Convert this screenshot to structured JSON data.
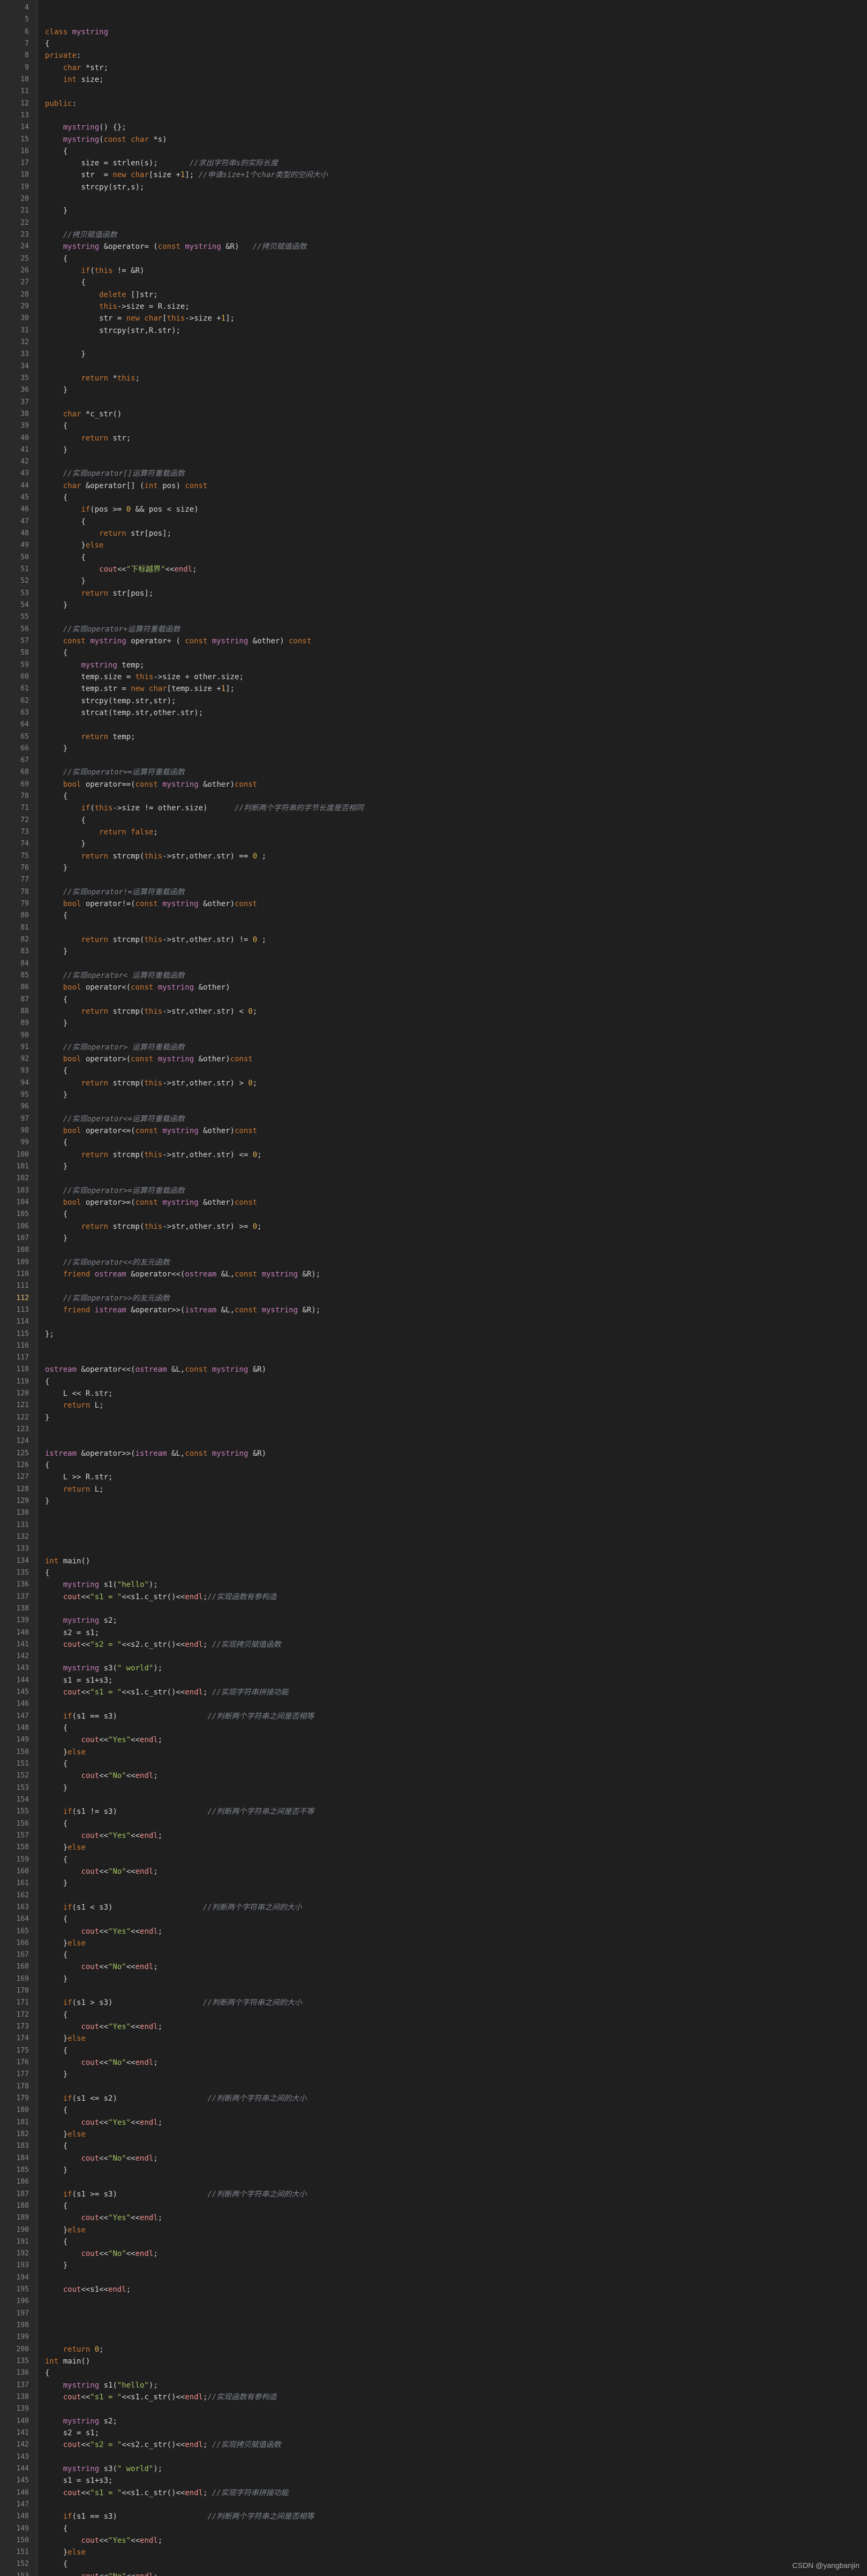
{
  "editor": {
    "active_line": 112,
    "lines": [
      {
        "n": 4,
        "t": ""
      },
      {
        "n": 5,
        "t": ""
      },
      {
        "n": 6,
        "t": "class mystring"
      },
      {
        "n": 7,
        "t": "{"
      },
      {
        "n": 8,
        "t": "private:"
      },
      {
        "n": 9,
        "t": "    char *str;"
      },
      {
        "n": 10,
        "t": "    int size;"
      },
      {
        "n": 11,
        "t": ""
      },
      {
        "n": 12,
        "t": "public:"
      },
      {
        "n": 13,
        "t": ""
      },
      {
        "n": 14,
        "t": "    mystring() {};"
      },
      {
        "n": 15,
        "t": "    mystring(const char *s)"
      },
      {
        "n": 16,
        "t": "    {"
      },
      {
        "n": 17,
        "t": "        size = strlen(s);       //求出字符串s的实际长度"
      },
      {
        "n": 18,
        "t": "        str  = new char[size +1]; //申请size+1个char类型的空间大小"
      },
      {
        "n": 19,
        "t": "        strcpy(str,s);"
      },
      {
        "n": 20,
        "t": ""
      },
      {
        "n": 21,
        "t": "    }"
      },
      {
        "n": 22,
        "t": ""
      },
      {
        "n": 23,
        "t": "    //拷贝赋值函数"
      },
      {
        "n": 24,
        "t": "    mystring &operator= (const mystring &R)   //拷贝赋值函数"
      },
      {
        "n": 25,
        "t": "    {"
      },
      {
        "n": 26,
        "t": "        if(this != &R)"
      },
      {
        "n": 27,
        "t": "        {"
      },
      {
        "n": 28,
        "t": "            delete []str;"
      },
      {
        "n": 29,
        "t": "            this->size = R.size;"
      },
      {
        "n": 30,
        "t": "            str = new char[this->size +1];"
      },
      {
        "n": 31,
        "t": "            strcpy(str,R.str);"
      },
      {
        "n": 32,
        "t": ""
      },
      {
        "n": 33,
        "t": "        }"
      },
      {
        "n": 34,
        "t": ""
      },
      {
        "n": 35,
        "t": "        return *this;"
      },
      {
        "n": 36,
        "t": "    }"
      },
      {
        "n": 37,
        "t": ""
      },
      {
        "n": 38,
        "t": "    char *c_str()"
      },
      {
        "n": 39,
        "t": "    {"
      },
      {
        "n": 40,
        "t": "        return str;"
      },
      {
        "n": 41,
        "t": "    }"
      },
      {
        "n": 42,
        "t": ""
      },
      {
        "n": 43,
        "t": "    //实现operator[]运算符重载函数"
      },
      {
        "n": 44,
        "t": "    char &operator[] (int pos) const"
      },
      {
        "n": 45,
        "t": "    {"
      },
      {
        "n": 46,
        "t": "        if(pos >= 0 && pos < size)"
      },
      {
        "n": 47,
        "t": "        {"
      },
      {
        "n": 48,
        "t": "            return str[pos];"
      },
      {
        "n": 49,
        "t": "        }else"
      },
      {
        "n": 50,
        "t": "        {"
      },
      {
        "n": 51,
        "t": "            cout<<\"下标越界\"<<endl;"
      },
      {
        "n": 52,
        "t": "        }"
      },
      {
        "n": 53,
        "t": "        return str[pos];"
      },
      {
        "n": 54,
        "t": "    }"
      },
      {
        "n": 55,
        "t": ""
      },
      {
        "n": 56,
        "t": "    //实现operator+运算符重载函数"
      },
      {
        "n": 57,
        "t": "    const mystring operator+ ( const mystring &other) const"
      },
      {
        "n": 58,
        "t": "    {"
      },
      {
        "n": 59,
        "t": "        mystring temp;"
      },
      {
        "n": 60,
        "t": "        temp.size = this->size + other.size;"
      },
      {
        "n": 61,
        "t": "        temp.str = new char[temp.size +1];"
      },
      {
        "n": 62,
        "t": "        strcpy(temp.str,str);"
      },
      {
        "n": 63,
        "t": "        strcat(temp.str,other.str);"
      },
      {
        "n": 64,
        "t": ""
      },
      {
        "n": 65,
        "t": "        return temp;"
      },
      {
        "n": 66,
        "t": "    }"
      },
      {
        "n": 67,
        "t": ""
      },
      {
        "n": 68,
        "t": "    //实现operator==运算符重载函数"
      },
      {
        "n": 69,
        "t": "    bool operator==(const mystring &other)const"
      },
      {
        "n": 70,
        "t": "    {"
      },
      {
        "n": 71,
        "t": "        if(this->size != other.size)      //判断两个字符串的字节长度是否相同"
      },
      {
        "n": 72,
        "t": "        {"
      },
      {
        "n": 73,
        "t": "            return false;"
      },
      {
        "n": 74,
        "t": "        }"
      },
      {
        "n": 75,
        "t": "        return strcmp(this->str,other.str) == 0 ;"
      },
      {
        "n": 76,
        "t": "    }"
      },
      {
        "n": 77,
        "t": ""
      },
      {
        "n": 78,
        "t": "    //实现operator!=运算符重载函数"
      },
      {
        "n": 79,
        "t": "    bool operator!=(const mystring &other)const"
      },
      {
        "n": 80,
        "t": "    {"
      },
      {
        "n": 81,
        "t": ""
      },
      {
        "n": 82,
        "t": "        return strcmp(this->str,other.str) != 0 ;"
      },
      {
        "n": 83,
        "t": "    }"
      },
      {
        "n": 84,
        "t": ""
      },
      {
        "n": 85,
        "t": "    //实现operator< 运算符重载函数"
      },
      {
        "n": 86,
        "t": "    bool operator<(const mystring &other)"
      },
      {
        "n": 87,
        "t": "    {"
      },
      {
        "n": 88,
        "t": "        return strcmp(this->str,other.str) < 0;"
      },
      {
        "n": 89,
        "t": "    }"
      },
      {
        "n": 90,
        "t": ""
      },
      {
        "n": 91,
        "t": "    //实现operator> 运算符重载函数"
      },
      {
        "n": 92,
        "t": "    bool operator>(const mystring &other)const"
      },
      {
        "n": 93,
        "t": "    {"
      },
      {
        "n": 94,
        "t": "        return strcmp(this->str,other.str) > 0;"
      },
      {
        "n": 95,
        "t": "    }"
      },
      {
        "n": 96,
        "t": ""
      },
      {
        "n": 97,
        "t": "    //实现operator<=运算符重载函数"
      },
      {
        "n": 98,
        "t": "    bool operator<=(const mystring &other)const"
      },
      {
        "n": 99,
        "t": "    {"
      },
      {
        "n": 100,
        "t": "        return strcmp(this->str,other.str) <= 0;"
      },
      {
        "n": 101,
        "t": "    }"
      },
      {
        "n": 102,
        "t": ""
      },
      {
        "n": 103,
        "t": "    //实现operator>=运算符重载函数"
      },
      {
        "n": 104,
        "t": "    bool operator>=(const mystring &other)const"
      },
      {
        "n": 105,
        "t": "    {"
      },
      {
        "n": 106,
        "t": "        return strcmp(this->str,other.str) >= 0;"
      },
      {
        "n": 107,
        "t": "    }"
      },
      {
        "n": 108,
        "t": ""
      },
      {
        "n": 109,
        "t": "    //实现operator<<的友元函数"
      },
      {
        "n": 110,
        "t": "    friend ostream &operator<<(ostream &L,const mystring &R);"
      },
      {
        "n": 111,
        "t": ""
      },
      {
        "n": 112,
        "t": "    //实现operator>>的友元函数"
      },
      {
        "n": 113,
        "t": "    friend istream &operator>>(istream &L,const mystring &R);"
      },
      {
        "n": 114,
        "t": ""
      },
      {
        "n": 115,
        "t": "};"
      },
      {
        "n": 116,
        "t": ""
      },
      {
        "n": 117,
        "t": ""
      },
      {
        "n": 118,
        "t": "ostream &operator<<(ostream &L,const mystring &R)"
      },
      {
        "n": 119,
        "t": "{"
      },
      {
        "n": 120,
        "t": "    L << R.str;"
      },
      {
        "n": 121,
        "t": "    return L;"
      },
      {
        "n": 122,
        "t": "}"
      },
      {
        "n": 123,
        "t": ""
      },
      {
        "n": 124,
        "t": ""
      },
      {
        "n": 125,
        "t": "istream &operator>>(istream &L,const mystring &R)"
      },
      {
        "n": 126,
        "t": "{"
      },
      {
        "n": 127,
        "t": "    L >> R.str;"
      },
      {
        "n": 128,
        "t": "    return L;"
      },
      {
        "n": 129,
        "t": "}"
      },
      {
        "n": 130,
        "t": ""
      },
      {
        "n": 131,
        "t": ""
      },
      {
        "n": 132,
        "t": ""
      },
      {
        "n": 133,
        "t": ""
      },
      {
        "n": 134,
        "t": "int main()"
      },
      {
        "n": 135,
        "t": "{"
      },
      {
        "n": 136,
        "t": "    mystring s1(\"hello\");"
      },
      {
        "n": 137,
        "t": "    cout<<\"s1 = \"<<s1.c_str()<<endl;//实现函数有参构造"
      },
      {
        "n": 138,
        "t": ""
      },
      {
        "n": 139,
        "t": "    mystring s2;"
      },
      {
        "n": 140,
        "t": "    s2 = s1;"
      },
      {
        "n": 141,
        "t": "    cout<<\"s2 = \"<<s2.c_str()<<endl; //实现拷贝赋值函数"
      },
      {
        "n": 142,
        "t": ""
      },
      {
        "n": 143,
        "t": "    mystring s3(\" world\");"
      },
      {
        "n": 144,
        "t": "    s1 = s1+s3;"
      },
      {
        "n": 145,
        "t": "    cout<<\"s1 = \"<<s1.c_str()<<endl; //实现字符串拼接功能"
      },
      {
        "n": 146,
        "t": ""
      },
      {
        "n": 147,
        "t": "    if(s1 == s3)                    //判断两个字符串之间是否相等"
      },
      {
        "n": 148,
        "t": "    {"
      },
      {
        "n": 149,
        "t": "        cout<<\"Yes\"<<endl;"
      },
      {
        "n": 150,
        "t": "    }else"
      },
      {
        "n": 151,
        "t": "    {"
      },
      {
        "n": 152,
        "t": "        cout<<\"No\"<<endl;"
      },
      {
        "n": 153,
        "t": "    }"
      },
      {
        "n": 154,
        "t": ""
      },
      {
        "n": 155,
        "t": "    if(s1 != s3)                    //判断两个字符串之间是否不等"
      },
      {
        "n": 156,
        "t": "    {"
      },
      {
        "n": 157,
        "t": "        cout<<\"Yes\"<<endl;"
      },
      {
        "n": 158,
        "t": "    }else"
      },
      {
        "n": 159,
        "t": "    {"
      },
      {
        "n": 160,
        "t": "        cout<<\"No\"<<endl;"
      },
      {
        "n": 161,
        "t": "    }"
      },
      {
        "n": 162,
        "t": ""
      },
      {
        "n": 163,
        "t": "    if(s1 < s3)                    //判断两个字符串之间的大小"
      },
      {
        "n": 164,
        "t": "    {"
      },
      {
        "n": 165,
        "t": "        cout<<\"Yes\"<<endl;"
      },
      {
        "n": 166,
        "t": "    }else"
      },
      {
        "n": 167,
        "t": "    {"
      },
      {
        "n": 168,
        "t": "        cout<<\"No\"<<endl;"
      },
      {
        "n": 169,
        "t": "    }"
      },
      {
        "n": 170,
        "t": ""
      },
      {
        "n": 171,
        "t": "    if(s1 > s3)                    //判断两个字符串之间的大小"
      },
      {
        "n": 172,
        "t": "    {"
      },
      {
        "n": 173,
        "t": "        cout<<\"Yes\"<<endl;"
      },
      {
        "n": 174,
        "t": "    }else"
      },
      {
        "n": 175,
        "t": "    {"
      },
      {
        "n": 176,
        "t": "        cout<<\"No\"<<endl;"
      },
      {
        "n": 177,
        "t": "    }"
      },
      {
        "n": 178,
        "t": ""
      },
      {
        "n": 179,
        "t": "    if(s1 <= s2)                    //判断两个字符串之间的大小"
      },
      {
        "n": 180,
        "t": "    {"
      },
      {
        "n": 181,
        "t": "        cout<<\"Yes\"<<endl;"
      },
      {
        "n": 182,
        "t": "    }else"
      },
      {
        "n": 183,
        "t": "    {"
      },
      {
        "n": 184,
        "t": "        cout<<\"No\"<<endl;"
      },
      {
        "n": 185,
        "t": "    }"
      },
      {
        "n": 186,
        "t": ""
      },
      {
        "n": 187,
        "t": "    if(s1 >= s3)                    //判断两个字符串之间的大小"
      },
      {
        "n": 188,
        "t": "    {"
      },
      {
        "n": 189,
        "t": "        cout<<\"Yes\"<<endl;"
      },
      {
        "n": 190,
        "t": "    }else"
      },
      {
        "n": 191,
        "t": "    {"
      },
      {
        "n": 192,
        "t": "        cout<<\"No\"<<endl;"
      },
      {
        "n": 193,
        "t": "    }"
      },
      {
        "n": 194,
        "t": ""
      },
      {
        "n": 195,
        "t": "    cout<<s1<<endl;"
      },
      {
        "n": 196,
        "t": ""
      },
      {
        "n": 197,
        "t": ""
      },
      {
        "n": 198,
        "t": ""
      },
      {
        "n": 199,
        "t": ""
      },
      {
        "n": 200,
        "t": "    return 0;"
      },
      {
        "n": 135,
        "t": "int main()"
      },
      {
        "n": 136,
        "t": "{"
      },
      {
        "n": 137,
        "t": "    mystring s1(\"hello\");"
      },
      {
        "n": 138,
        "t": "    cout<<\"s1 = \"<<s1.c_str()<<endl;//实现函数有参构造"
      },
      {
        "n": 139,
        "t": ""
      },
      {
        "n": 140,
        "t": "    mystring s2;"
      },
      {
        "n": 141,
        "t": "    s2 = s1;"
      },
      {
        "n": 142,
        "t": "    cout<<\"s2 = \"<<s2.c_str()<<endl; //实现拷贝赋值函数"
      },
      {
        "n": 143,
        "t": ""
      },
      {
        "n": 144,
        "t": "    mystring s3(\" world\");"
      },
      {
        "n": 145,
        "t": "    s1 = s1+s3;"
      },
      {
        "n": 146,
        "t": "    cout<<\"s1 = \"<<s1.c_str()<<endl; //实现字符串拼接功能"
      },
      {
        "n": 147,
        "t": ""
      },
      {
        "n": 148,
        "t": "    if(s1 == s3)                    //判断两个字符串之间是否相等"
      },
      {
        "n": 149,
        "t": "    {"
      },
      {
        "n": 150,
        "t": "        cout<<\"Yes\"<<endl;"
      },
      {
        "n": 151,
        "t": "    }else"
      },
      {
        "n": 152,
        "t": "    {"
      },
      {
        "n": 153,
        "t": "        cout<<\"No\"<<endl;"
      }
    ]
  },
  "footer": {
    "watermark": "CSDN @yangbanjin"
  },
  "colors": {
    "background": "#1f1f1f",
    "gutter": "#2a2a2a",
    "keyword": "#cc7832",
    "type": "#c77dbb",
    "comment": "#7f848e",
    "string": "#a5c261",
    "number": "#e0b04f"
  }
}
